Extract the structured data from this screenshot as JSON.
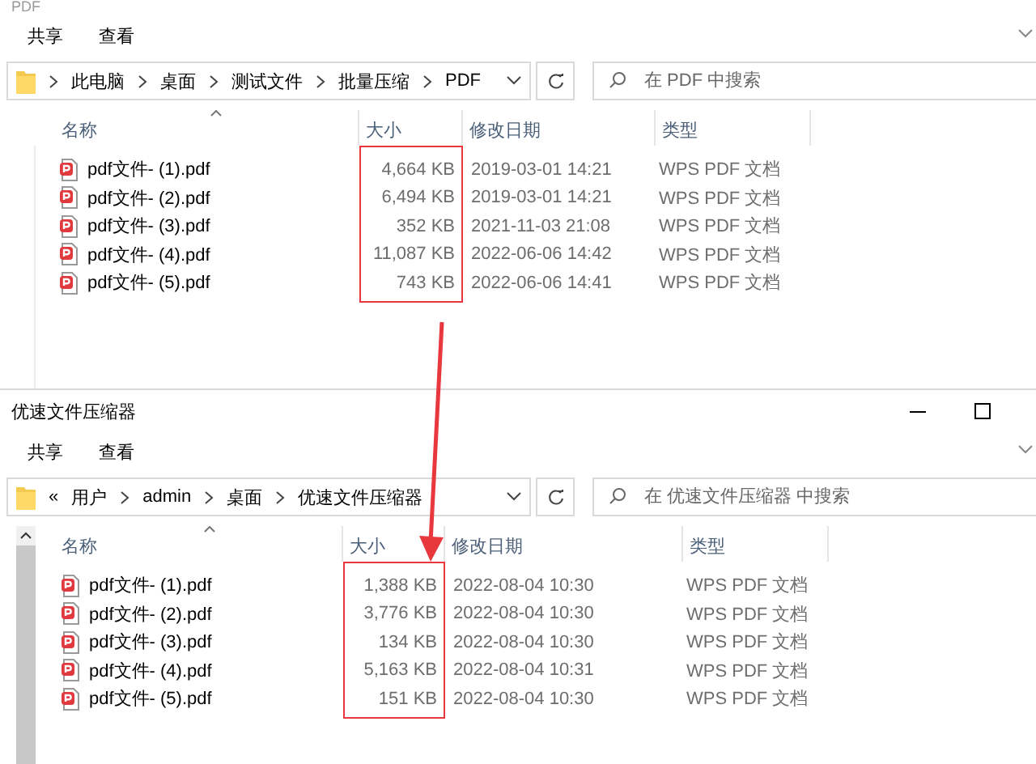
{
  "windows": [
    {
      "title": "PDF",
      "kind": "cut",
      "ribbon_tabs": [
        "共享",
        "查看"
      ],
      "breadcrumbs": [
        "此电脑",
        "桌面",
        "测试文件",
        "批量压缩",
        "PDF"
      ],
      "search": {
        "placeholder": "在 PDF 中搜索"
      },
      "scrollbar": false,
      "columns": [
        "名称",
        "大小",
        "修改日期",
        "类型"
      ],
      "size_highlight": true,
      "files": [
        {
          "name": "pdf文件- (1).pdf",
          "size": "4,664 KB",
          "modified": "2019-03-01 14:21",
          "type": "WPS PDF 文档"
        },
        {
          "name": "pdf文件- (2).pdf",
          "size": "6,494 KB",
          "modified": "2019-03-01 14:21",
          "type": "WPS PDF 文档"
        },
        {
          "name": "pdf文件- (3).pdf",
          "size": "352 KB",
          "modified": "2021-11-03 21:08",
          "type": "WPS PDF 文档"
        },
        {
          "name": "pdf文件- (4).pdf",
          "size": "11,087 KB",
          "modified": "2022-06-06 14:42",
          "type": "WPS PDF 文档"
        },
        {
          "name": "pdf文件- (5).pdf",
          "size": "743 KB",
          "modified": "2022-06-06 14:41",
          "type": "WPS PDF 文档"
        }
      ]
    },
    {
      "title": "优速文件压缩器",
      "kind": "full",
      "ribbon_tabs": [
        "共享",
        "查看"
      ],
      "overflow_mark": "«",
      "breadcrumbs": [
        "用户",
        "admin",
        "桌面",
        "优速文件压缩器"
      ],
      "search": {
        "placeholder": "在 优速文件压缩器 中搜索"
      },
      "scrollbar": true,
      "columns": [
        "名称",
        "大小",
        "修改日期",
        "类型"
      ],
      "size_highlight": true,
      "files": [
        {
          "name": "pdf文件- (1).pdf",
          "size": "1,388 KB",
          "modified": "2022-08-04 10:30",
          "type": "WPS PDF 文档"
        },
        {
          "name": "pdf文件- (2).pdf",
          "size": "3,776 KB",
          "modified": "2022-08-04 10:30",
          "type": "WPS PDF 文档"
        },
        {
          "name": "pdf文件- (3).pdf",
          "size": "134 KB",
          "modified": "2022-08-04 10:30",
          "type": "WPS PDF 文档"
        },
        {
          "name": "pdf文件- (4).pdf",
          "size": "5,163 KB",
          "modified": "2022-08-04 10:31",
          "type": "WPS PDF 文档"
        },
        {
          "name": "pdf文件- (5).pdf",
          "size": "151 KB",
          "modified": "2022-08-04 10:30",
          "type": "WPS PDF 文档"
        }
      ]
    }
  ],
  "annotation": {
    "arrow": true
  }
}
